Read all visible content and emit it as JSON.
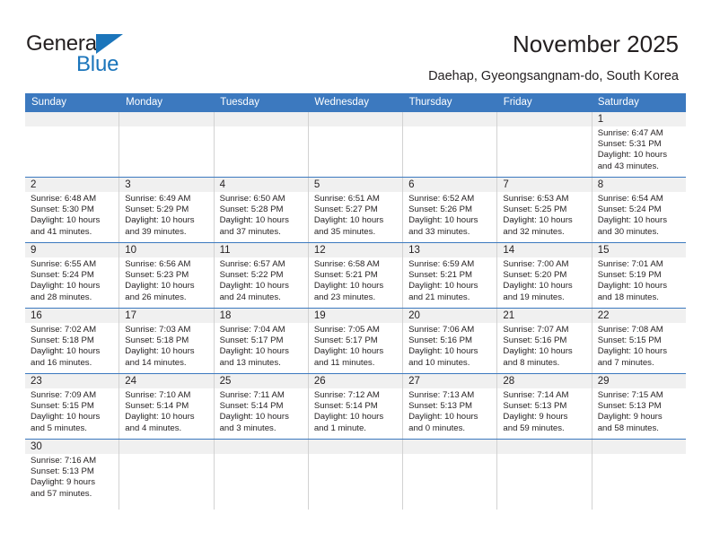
{
  "brand": {
    "name_top": "General",
    "name_bottom": "Blue",
    "accent_color": "#1b75bb"
  },
  "header": {
    "title": "November 2025",
    "subtitle": "Daehap, Gyeongsangnam-do, South Korea",
    "header_bg_color": "#3c79bf",
    "band_color": "#f0f0f0"
  },
  "calendar": {
    "weekday_headers": [
      "Sunday",
      "Monday",
      "Tuesday",
      "Wednesday",
      "Thursday",
      "Friday",
      "Saturday"
    ],
    "weeks": [
      [
        {
          "day": "",
          "lines": []
        },
        {
          "day": "",
          "lines": []
        },
        {
          "day": "",
          "lines": []
        },
        {
          "day": "",
          "lines": []
        },
        {
          "day": "",
          "lines": []
        },
        {
          "day": "",
          "lines": []
        },
        {
          "day": "1",
          "lines": [
            "Sunrise: 6:47 AM",
            "Sunset: 5:31 PM",
            "Daylight: 10 hours",
            "and 43 minutes."
          ]
        }
      ],
      [
        {
          "day": "2",
          "lines": [
            "Sunrise: 6:48 AM",
            "Sunset: 5:30 PM",
            "Daylight: 10 hours",
            "and 41 minutes."
          ]
        },
        {
          "day": "3",
          "lines": [
            "Sunrise: 6:49 AM",
            "Sunset: 5:29 PM",
            "Daylight: 10 hours",
            "and 39 minutes."
          ]
        },
        {
          "day": "4",
          "lines": [
            "Sunrise: 6:50 AM",
            "Sunset: 5:28 PM",
            "Daylight: 10 hours",
            "and 37 minutes."
          ]
        },
        {
          "day": "5",
          "lines": [
            "Sunrise: 6:51 AM",
            "Sunset: 5:27 PM",
            "Daylight: 10 hours",
            "and 35 minutes."
          ]
        },
        {
          "day": "6",
          "lines": [
            "Sunrise: 6:52 AM",
            "Sunset: 5:26 PM",
            "Daylight: 10 hours",
            "and 33 minutes."
          ]
        },
        {
          "day": "7",
          "lines": [
            "Sunrise: 6:53 AM",
            "Sunset: 5:25 PM",
            "Daylight: 10 hours",
            "and 32 minutes."
          ]
        },
        {
          "day": "8",
          "lines": [
            "Sunrise: 6:54 AM",
            "Sunset: 5:24 PM",
            "Daylight: 10 hours",
            "and 30 minutes."
          ]
        }
      ],
      [
        {
          "day": "9",
          "lines": [
            "Sunrise: 6:55 AM",
            "Sunset: 5:24 PM",
            "Daylight: 10 hours",
            "and 28 minutes."
          ]
        },
        {
          "day": "10",
          "lines": [
            "Sunrise: 6:56 AM",
            "Sunset: 5:23 PM",
            "Daylight: 10 hours",
            "and 26 minutes."
          ]
        },
        {
          "day": "11",
          "lines": [
            "Sunrise: 6:57 AM",
            "Sunset: 5:22 PM",
            "Daylight: 10 hours",
            "and 24 minutes."
          ]
        },
        {
          "day": "12",
          "lines": [
            "Sunrise: 6:58 AM",
            "Sunset: 5:21 PM",
            "Daylight: 10 hours",
            "and 23 minutes."
          ]
        },
        {
          "day": "13",
          "lines": [
            "Sunrise: 6:59 AM",
            "Sunset: 5:21 PM",
            "Daylight: 10 hours",
            "and 21 minutes."
          ]
        },
        {
          "day": "14",
          "lines": [
            "Sunrise: 7:00 AM",
            "Sunset: 5:20 PM",
            "Daylight: 10 hours",
            "and 19 minutes."
          ]
        },
        {
          "day": "15",
          "lines": [
            "Sunrise: 7:01 AM",
            "Sunset: 5:19 PM",
            "Daylight: 10 hours",
            "and 18 minutes."
          ]
        }
      ],
      [
        {
          "day": "16",
          "lines": [
            "Sunrise: 7:02 AM",
            "Sunset: 5:18 PM",
            "Daylight: 10 hours",
            "and 16 minutes."
          ]
        },
        {
          "day": "17",
          "lines": [
            "Sunrise: 7:03 AM",
            "Sunset: 5:18 PM",
            "Daylight: 10 hours",
            "and 14 minutes."
          ]
        },
        {
          "day": "18",
          "lines": [
            "Sunrise: 7:04 AM",
            "Sunset: 5:17 PM",
            "Daylight: 10 hours",
            "and 13 minutes."
          ]
        },
        {
          "day": "19",
          "lines": [
            "Sunrise: 7:05 AM",
            "Sunset: 5:17 PM",
            "Daylight: 10 hours",
            "and 11 minutes."
          ]
        },
        {
          "day": "20",
          "lines": [
            "Sunrise: 7:06 AM",
            "Sunset: 5:16 PM",
            "Daylight: 10 hours",
            "and 10 minutes."
          ]
        },
        {
          "day": "21",
          "lines": [
            "Sunrise: 7:07 AM",
            "Sunset: 5:16 PM",
            "Daylight: 10 hours",
            "and 8 minutes."
          ]
        },
        {
          "day": "22",
          "lines": [
            "Sunrise: 7:08 AM",
            "Sunset: 5:15 PM",
            "Daylight: 10 hours",
            "and 7 minutes."
          ]
        }
      ],
      [
        {
          "day": "23",
          "lines": [
            "Sunrise: 7:09 AM",
            "Sunset: 5:15 PM",
            "Daylight: 10 hours",
            "and 5 minutes."
          ]
        },
        {
          "day": "24",
          "lines": [
            "Sunrise: 7:10 AM",
            "Sunset: 5:14 PM",
            "Daylight: 10 hours",
            "and 4 minutes."
          ]
        },
        {
          "day": "25",
          "lines": [
            "Sunrise: 7:11 AM",
            "Sunset: 5:14 PM",
            "Daylight: 10 hours",
            "and 3 minutes."
          ]
        },
        {
          "day": "26",
          "lines": [
            "Sunrise: 7:12 AM",
            "Sunset: 5:14 PM",
            "Daylight: 10 hours",
            "and 1 minute."
          ]
        },
        {
          "day": "27",
          "lines": [
            "Sunrise: 7:13 AM",
            "Sunset: 5:13 PM",
            "Daylight: 10 hours",
            "and 0 minutes."
          ]
        },
        {
          "day": "28",
          "lines": [
            "Sunrise: 7:14 AM",
            "Sunset: 5:13 PM",
            "Daylight: 9 hours",
            "and 59 minutes."
          ]
        },
        {
          "day": "29",
          "lines": [
            "Sunrise: 7:15 AM",
            "Sunset: 5:13 PM",
            "Daylight: 9 hours",
            "and 58 minutes."
          ]
        }
      ],
      [
        {
          "day": "30",
          "lines": [
            "Sunrise: 7:16 AM",
            "Sunset: 5:13 PM",
            "Daylight: 9 hours",
            "and 57 minutes."
          ]
        },
        {
          "day": "",
          "lines": []
        },
        {
          "day": "",
          "lines": []
        },
        {
          "day": "",
          "lines": []
        },
        {
          "day": "",
          "lines": []
        },
        {
          "day": "",
          "lines": []
        },
        {
          "day": "",
          "lines": []
        }
      ]
    ]
  }
}
